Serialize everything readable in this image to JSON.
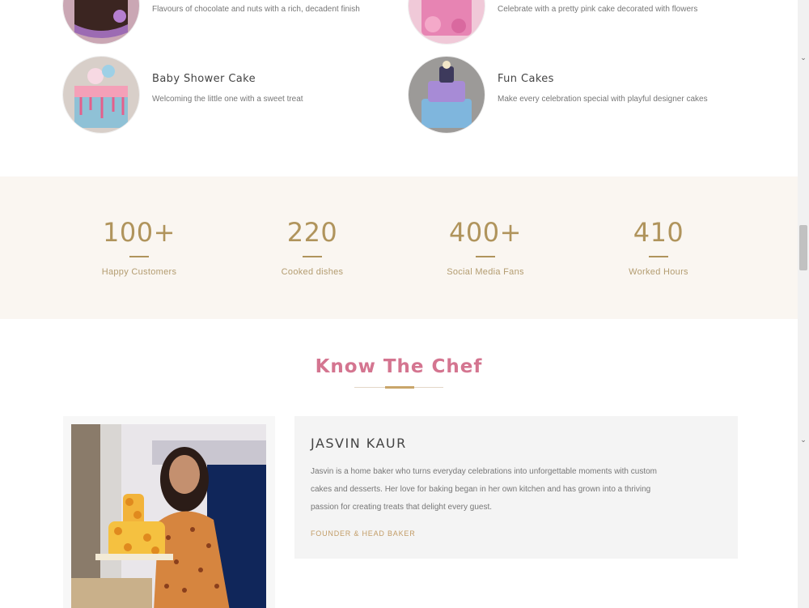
{
  "cakes": [
    {
      "name": "",
      "description": "Flavours of chocolate and nuts with a rich, decadent finish",
      "image": "chocolate-cake-photo"
    },
    {
      "name": "",
      "description": "Celebrate with a pretty pink cake decorated with flowers",
      "image": "pink-cake-photo"
    },
    {
      "name": "Baby Shower Cake",
      "description": "Welcoming the little one with a sweet treat",
      "image": "baby-shower-cake-photo"
    },
    {
      "name": "Fun Cakes",
      "description": "Make every celebration special with playful designer cakes",
      "image": "fun-cake-photo"
    }
  ],
  "counters": [
    {
      "value": "100+",
      "label": "Happy Customers"
    },
    {
      "value": "220",
      "label": "Cooked dishes"
    },
    {
      "value": "400+",
      "label": "Social Media Fans"
    },
    {
      "value": "410",
      "label": "Worked Hours"
    }
  ],
  "chef_section": {
    "title": "Know The Chef",
    "name": "JASVIN KAUR",
    "bio_line1": "Jasvin is a home baker who turns everyday celebrations into unforgettable moments with custom",
    "bio_line2": "cakes and desserts. Her love for baking began in her own kitchen and has grown into a thriving",
    "bio_line3": "passion for creating treats that delight every guest.",
    "meta": "FOUNDER & HEAD BAKER"
  },
  "scrollbar": {
    "thumb_position": 0.4
  },
  "colors": {
    "accent_gold": "#b0945c",
    "chef_title_pink": "#d47590",
    "band_bg": "#faf6f1",
    "card_bg": "#f4f4f4"
  }
}
